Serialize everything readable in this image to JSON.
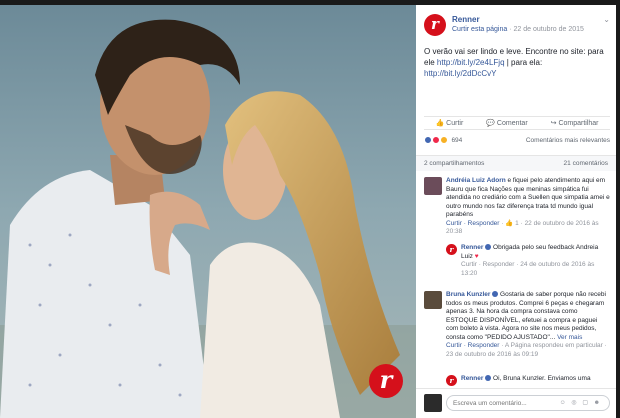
{
  "post": {
    "page_name": "Renner",
    "like_page": "Curtir esta página",
    "sep": " · ",
    "date": "22 de outubro de 2015",
    "text": "O verão vai ser lindo e leve. Encontre no site: para ele",
    "link1": "http://bit.ly/2e4LFjq",
    "text2": " | para ela:",
    "link2": "http://bit.ly/2dDcCvY"
  },
  "actions": {
    "like": "Curtir",
    "comment": "Comentar",
    "share": "Compartilhar"
  },
  "reactions": {
    "count": "694",
    "relevance": "Comentários mais relevantes"
  },
  "stats": {
    "shares": "2 compartilhamentos",
    "comments": "21 comentários"
  },
  "comments": [
    {
      "author": "Andréia Luiz Adorn",
      "text": "e fiquei pelo atendimento aqui em Bauru que fica Nações que meninas simpática fui atendida no crediário com a Suellen que simpatia amei e outro mundo nos faz diferença trata td mundo igual parabéns",
      "reply_label": "Curtir · Responder",
      "likes": "1",
      "date": "22 de outubro de 2016 às 20:38"
    },
    {
      "author": "Bruna Kunzler",
      "text": "Gostaria de saber porque não recebi todos os meus produtos. Comprei 6 peças e chegaram apenas 3. Na hora da compra constava como ESTOQUE DISPONÍVEL, efetuei a compra e paguei com boleto à vista. Agora no site nos meus pedidos, consta como \"PEDIDO AJUSTADO\"...",
      "more": "Ver mais",
      "reply_label": "Curtir · Responder",
      "responded": "A Página respondeu em particular",
      "date": "23 de outubro de 2016 às 09:19"
    }
  ],
  "replies": [
    {
      "author": "Renner",
      "text": "Obrigada pelo seu feedback Andreia Luiz",
      "heart": "♥",
      "meta": "Curtir · Responder · 24 de outubro de 2016 às 13:20"
    },
    {
      "author": "Renner",
      "text": "Oi, Bruna Kunzler. Enviamos uma"
    }
  ],
  "composer": {
    "placeholder": "Escreva um comentário...",
    "icons": "☺ ◎ ▢ ☻"
  },
  "brand": {
    "letter": "r",
    "color": "#d5101b"
  },
  "close_glyph": "×",
  "chevron": "⌄",
  "dot": "·"
}
